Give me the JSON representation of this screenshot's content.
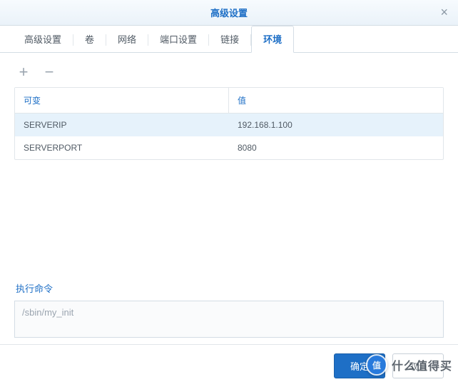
{
  "dialog": {
    "title": "高级设置",
    "close": "×"
  },
  "tabs": {
    "items": [
      "高级设置",
      "卷",
      "网络",
      "端口设置",
      "链接",
      "环境"
    ],
    "active_index": 5
  },
  "toolbar": {
    "add": "+",
    "remove": "−"
  },
  "table": {
    "headers": {
      "variable": "可变",
      "value": "值"
    },
    "rows": [
      {
        "variable": "SERVERIP",
        "value": "192.168.1.100"
      },
      {
        "variable": "SERVERPORT",
        "value": "8080"
      }
    ]
  },
  "command": {
    "label": "执行命令",
    "value": "/sbin/my_init"
  },
  "footer": {
    "ok": "确定",
    "cancel": "取消"
  },
  "watermark": {
    "badge": "值",
    "text": "什么值得买"
  }
}
